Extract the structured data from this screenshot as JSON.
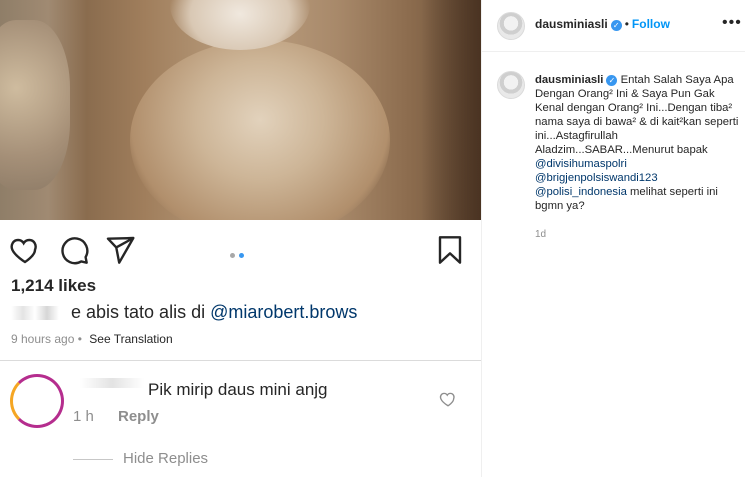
{
  "post": {
    "likes": "1,214 likes",
    "caption_text": "e abis tato alis di ",
    "caption_mention": "@miarobert.brows",
    "timestamp": "9 hours ago",
    "see_translation": "See Translation",
    "carousel_dots": 2,
    "carousel_active": 2
  },
  "comment": {
    "text": "Pik mirip daus mini anjg",
    "time": "1 h",
    "reply_label": "Reply",
    "hide_replies": "Hide Replies"
  },
  "sidebar": {
    "username": "dausminiasli",
    "separator": "•",
    "follow_label": "Follow",
    "more_icon": "•••",
    "caption_user": "dausminiasli",
    "caption_body": "Entah Salah Saya Apa Dengan Orang² Ini & Saya Pun Gak Kenal dengan Orang² Ini...Dengan tiba² nama saya di bawa² & di kait²kan seperti ini...Astagfirullah Aladzim...SABAR...Menurut bapak",
    "mentions": [
      "@divisihumaspolri",
      "@brigjenpolsiswandi123",
      "@polisi_indonesia"
    ],
    "caption_tail": "melihat seperti ini bgmn ya?",
    "age": "1d"
  },
  "colors": {
    "link": "#00376b",
    "follow": "#0095f6",
    "verified": "#3897f0",
    "muted": "#8e8e8e",
    "dot_inactive": "#a8a8a8"
  },
  "icons": [
    "heart-icon",
    "comment-icon",
    "share-icon",
    "bookmark-icon",
    "verified-badge-icon"
  ]
}
